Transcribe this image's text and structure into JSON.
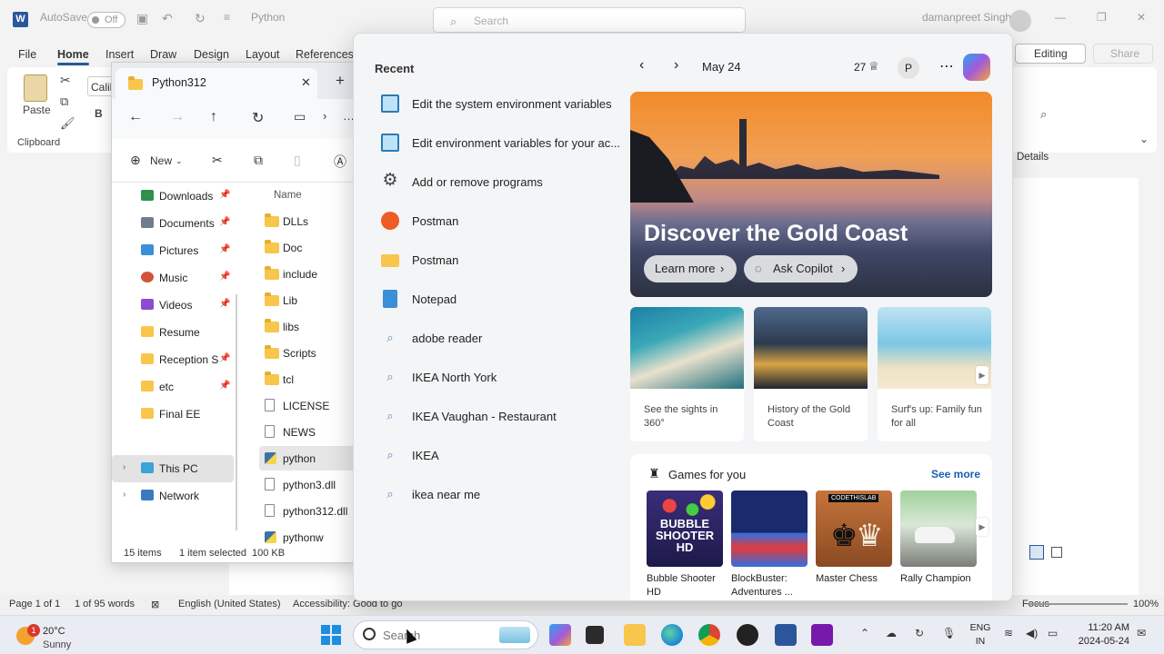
{
  "word": {
    "autosave_label": "AutoSave",
    "autosave_state": "Off",
    "doc_title": "Python",
    "search_placeholder": "Search",
    "user_name": "damanpreet Singh",
    "menu": [
      "File",
      "Home",
      "Insert",
      "Draw",
      "Design",
      "Layout",
      "References"
    ],
    "editing_label": "Editing",
    "share_label": "Share",
    "paste_label": "Paste",
    "clipboard_label": "Clipboard",
    "font_name_partial": "Calib",
    "details_label": "Details",
    "status": {
      "page": "Page 1 of 1",
      "words": "1 of 95 words",
      "language": "English (United States)",
      "accessibility": "Accessibility: Good to go",
      "focus": "Focus",
      "zoom": "100%"
    }
  },
  "explorer": {
    "tab_title": "Python312",
    "new_label": "New",
    "name_column": "Name",
    "nav_items": [
      {
        "label": "Downloads",
        "color": "#2f8f4e"
      },
      {
        "label": "Documents",
        "color": "#6f7d8c"
      },
      {
        "label": "Pictures",
        "color": "#3b8ed8"
      },
      {
        "label": "Music",
        "color": "#d2533c"
      },
      {
        "label": "Videos",
        "color": "#8c4bd0"
      },
      {
        "label": "Resume",
        "color": "#f7c64b"
      },
      {
        "label": "Reception Sh",
        "color": "#f7c64b"
      },
      {
        "label": "etc",
        "color": "#f7c64b"
      },
      {
        "label": "Final EE",
        "color": "#f7c64b"
      }
    ],
    "this_pc": "This PC",
    "network": "Network",
    "files": [
      "DLLs",
      "Doc",
      "include",
      "Lib",
      "libs",
      "Scripts",
      "tcl",
      "LICENSE",
      "NEWS",
      "python",
      "python3.dll",
      "python312.dll",
      "pythonw"
    ],
    "status_count": "15 items",
    "status_selected": "1 item selected",
    "status_size": "100 KB"
  },
  "flyout": {
    "recent_title": "Recent",
    "recent": [
      "Edit the system environment variables",
      "Edit environment variables for your ac...",
      "Add or remove programs",
      "Postman",
      "Postman",
      "Notepad",
      "adobe reader",
      "IKEA North York",
      "IKEA Vaughan - Restaurant",
      "IKEA",
      "ikea near me"
    ],
    "date": "May 24",
    "points": "27",
    "profile_initial": "P",
    "hero_title": "Discover the Gold Coast",
    "learn_more": "Learn more",
    "ask_copilot": "Ask Copilot",
    "cards": [
      "See the sights in 360°",
      "History of the Gold Coast",
      "Surf's up: Family fun for all"
    ],
    "games_title": "Games for you",
    "see_more": "See more",
    "games": [
      {
        "name": "Bubble Shooter HD",
        "tile_text": "BUBBLE SHOOTER HD"
      },
      {
        "name": "BlockBuster: Adventures ...",
        "tile_text": ""
      },
      {
        "name": "Master Chess",
        "tile_text": "CODETHISLAB"
      },
      {
        "name": "Rally Champion",
        "tile_text": ""
      }
    ]
  },
  "taskbar": {
    "temperature": "20°C",
    "condition": "Sunny",
    "notification_count": "1",
    "search_placeholder": "Search",
    "lang_top": "ENG",
    "lang_bottom": "IN",
    "time": "11:20 AM",
    "date": "2024-05-24"
  }
}
